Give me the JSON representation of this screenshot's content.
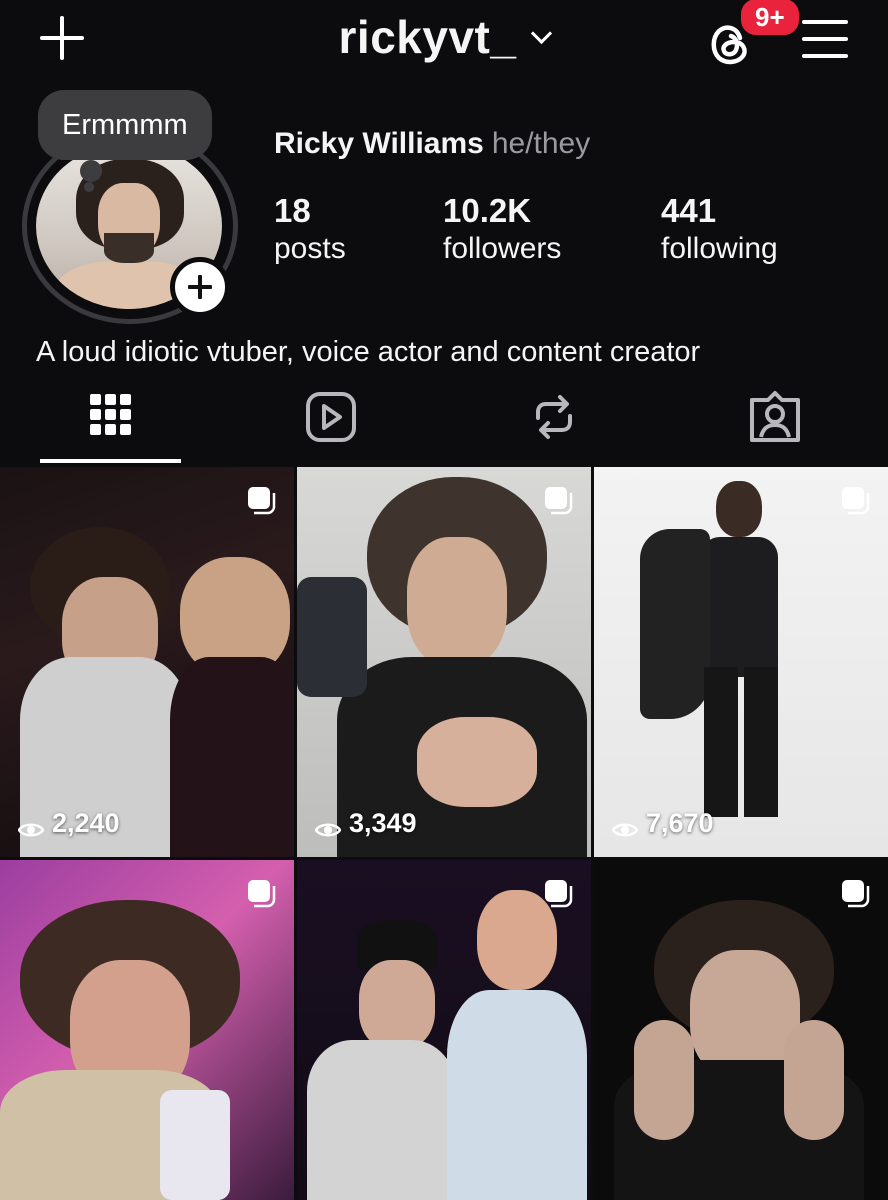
{
  "header": {
    "username": "rickyvt_",
    "notification_badge": "9+",
    "icons": [
      "plus-icon",
      "chevron-down-icon",
      "threads-icon",
      "menu-icon"
    ]
  },
  "profile": {
    "note": "Ermmmm",
    "name": "Ricky Williams",
    "pronouns": "he/they",
    "stats": {
      "posts_count": "18",
      "posts_label": "posts",
      "followers_count": "10.2K",
      "followers_label": "followers",
      "following_count": "441",
      "following_label": "following"
    },
    "bio": "A loud idiotic vtuber, voice actor and content creator"
  },
  "tabs": [
    "grid-icon",
    "reels-icon",
    "reposts-icon",
    "tagged-icon"
  ],
  "posts": [
    {
      "views": "2,240"
    },
    {
      "views": "3,349"
    },
    {
      "views": "7,670"
    },
    {
      "views": ""
    },
    {
      "views": ""
    },
    {
      "views": ""
    }
  ],
  "colors": {
    "background": "#0c0c0e",
    "badge": "#e8233b",
    "note_bubble": "#3d3d40",
    "muted_text": "#9a9aa0"
  }
}
